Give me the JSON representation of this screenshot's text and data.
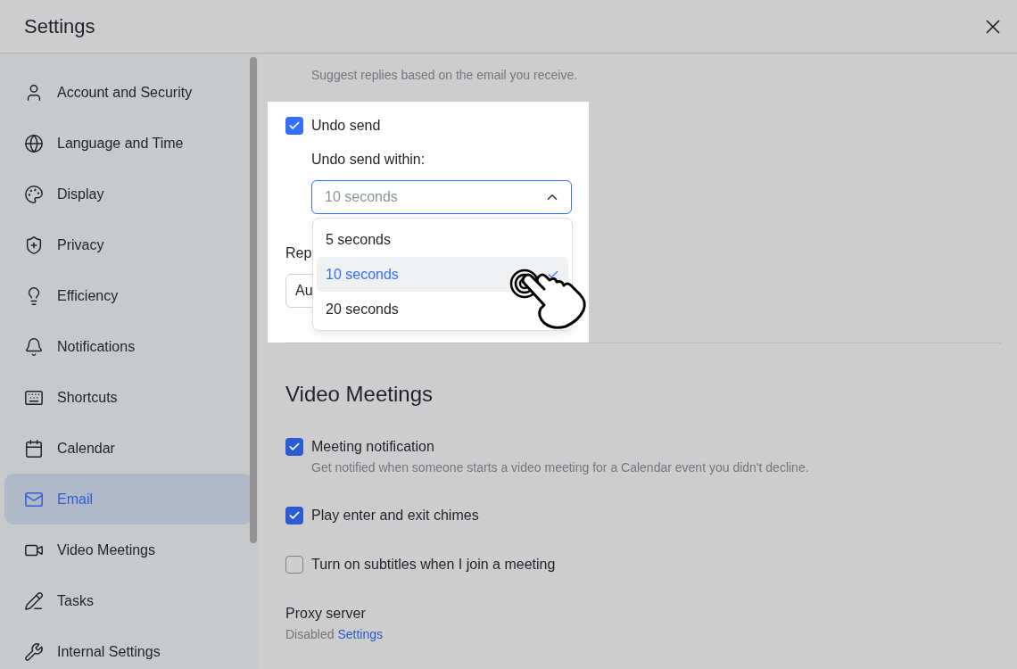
{
  "window": {
    "title": "Settings"
  },
  "sidebar": {
    "items": [
      {
        "label": "Account and Security",
        "selected": false
      },
      {
        "label": "Language and Time",
        "selected": false
      },
      {
        "label": "Display",
        "selected": false
      },
      {
        "label": "Privacy",
        "selected": false
      },
      {
        "label": "Efficiency",
        "selected": false
      },
      {
        "label": "Notifications",
        "selected": false
      },
      {
        "label": "Shortcuts",
        "selected": false
      },
      {
        "label": "Calendar",
        "selected": false
      },
      {
        "label": "Email",
        "selected": true
      },
      {
        "label": "Video Meetings",
        "selected": false
      },
      {
        "label": "Tasks",
        "selected": false
      },
      {
        "label": "Internal Settings",
        "selected": false
      }
    ]
  },
  "email_section": {
    "hint": "Suggest replies based on the email you receive.",
    "undo_send": {
      "label": "Undo send",
      "checked": true
    },
    "within_label": "Undo send within:",
    "select": {
      "value": "10 seconds",
      "expanded": true
    },
    "options": [
      {
        "label": "5 seconds",
        "selected": false
      },
      {
        "label": "10 seconds",
        "selected": true
      },
      {
        "label": "20 seconds",
        "selected": false
      }
    ],
    "reply_label": "Rep",
    "reply_field": {
      "value": "Au"
    }
  },
  "video_meetings": {
    "title": "Video Meetings",
    "options": [
      {
        "label": "Meeting notification",
        "description": "Get notified when someone starts a video meeting for a Calendar event you didn't decline.",
        "checked": true
      },
      {
        "label": "Play enter and exit chimes",
        "checked": true
      },
      {
        "label": "Turn on subtitles when I join a meeting",
        "checked": false
      }
    ],
    "proxy": {
      "label": "Proxy server",
      "status": "Disabled",
      "link": "Settings"
    }
  }
}
